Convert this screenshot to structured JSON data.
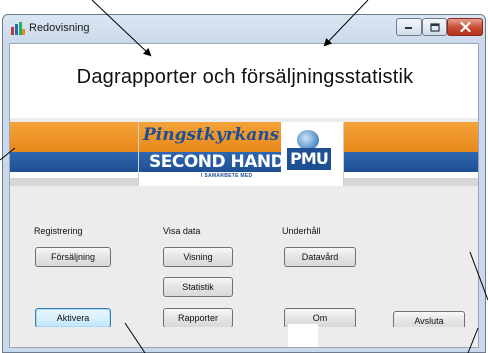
{
  "window": {
    "title": "Redovisning"
  },
  "heading": "Dagrapporter och försäljningsstatistik",
  "banner": {
    "script_text": "Pingstkyrkans",
    "main_text": "SECOND HAND",
    "sub_text": "I SAMARBETE MED",
    "logo_text": "PMU"
  },
  "groups": {
    "registrering": "Registrering",
    "visa_data": "Visa data",
    "underhall": "Underhåll"
  },
  "buttons": {
    "forsaljning": "Försäljning",
    "visning": "Visning",
    "datavard": "Datavård",
    "statistik": "Statistik",
    "aktivera": "Aktivera",
    "rapporter": "Rapporter",
    "om": "Om",
    "avsluta": "Avsluta"
  },
  "colors": {
    "banner_orange": "#e8891b",
    "banner_blue": "#1f4f93",
    "client_bg": "#ececec",
    "close_red": "#c74a31"
  },
  "icons": {
    "app": "bar-chart-icon",
    "minimize": "minimize-icon",
    "maximize": "maximize-icon",
    "close": "close-icon"
  }
}
